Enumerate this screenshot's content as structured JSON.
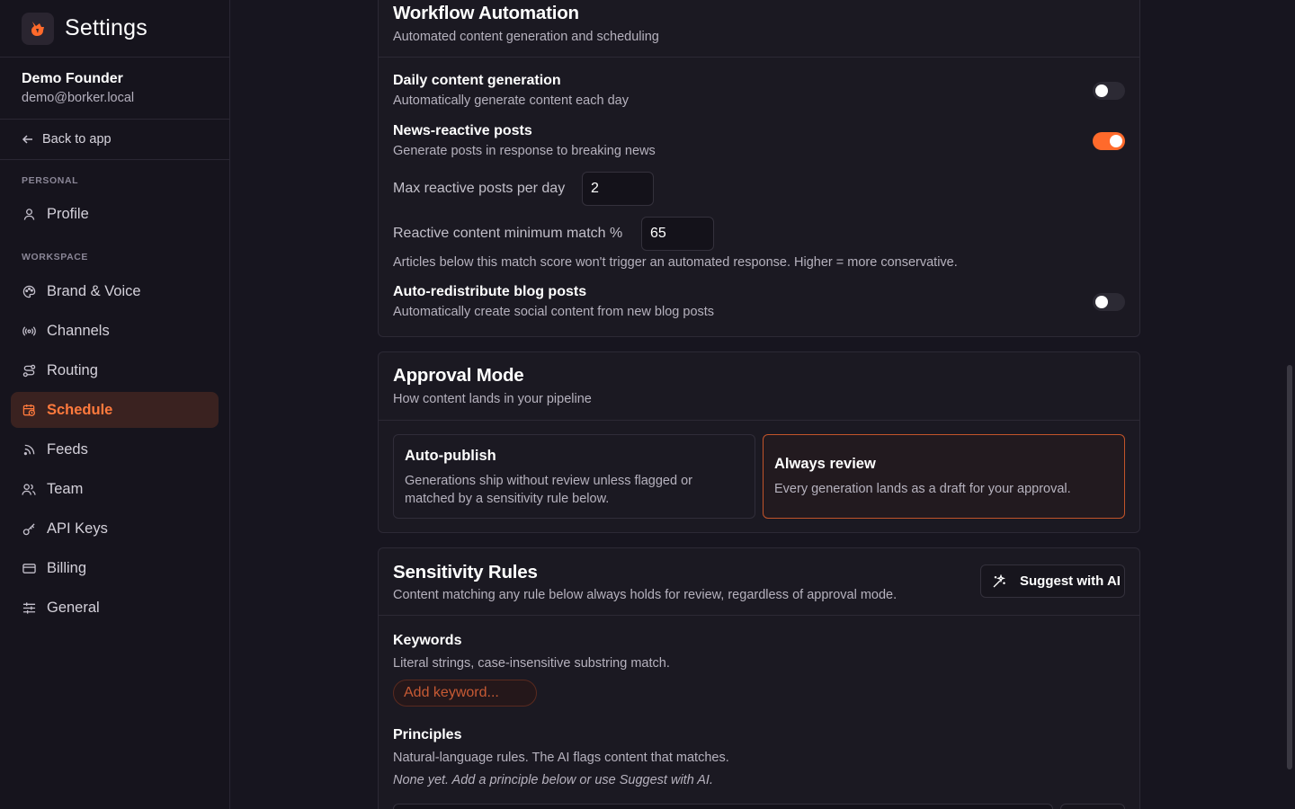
{
  "app": {
    "title": "Settings"
  },
  "user": {
    "name": "Demo Founder",
    "email": "demo@borker.local"
  },
  "back": {
    "label": "Back to app"
  },
  "sidebar": {
    "personal_label": "PERSONAL",
    "workspace_label": "WORKSPACE",
    "items": [
      {
        "label": "Profile",
        "icon": "user-icon"
      },
      {
        "label": "Brand & Voice",
        "icon": "palette-icon"
      },
      {
        "label": "Channels",
        "icon": "broadcast-icon"
      },
      {
        "label": "Routing",
        "icon": "route-icon"
      },
      {
        "label": "Schedule",
        "icon": "calendar-clock-icon",
        "active": true
      },
      {
        "label": "Feeds",
        "icon": "rss-icon"
      },
      {
        "label": "Team",
        "icon": "team-icon"
      },
      {
        "label": "API Keys",
        "icon": "key-icon"
      },
      {
        "label": "Billing",
        "icon": "credit-card-icon"
      },
      {
        "label": "General",
        "icon": "sliders-icon"
      }
    ]
  },
  "workflow": {
    "title": "Workflow Automation",
    "subtitle": "Automated content generation and scheduling",
    "daily": {
      "title": "Daily content generation",
      "desc": "Automatically generate content each day",
      "enabled": false
    },
    "news": {
      "title": "News-reactive posts",
      "desc": "Generate posts in response to breaking news",
      "enabled": true
    },
    "max_reactive": {
      "label": "Max reactive posts per day",
      "value": "2"
    },
    "min_match": {
      "label": "Reactive content minimum match %",
      "value": "65"
    },
    "match_help": "Articles below this match score won't trigger an automated response. Higher = more conservative.",
    "redistribute": {
      "title": "Auto-redistribute blog posts",
      "desc": "Automatically create social content from new blog posts",
      "enabled": false
    }
  },
  "approval": {
    "title": "Approval Mode",
    "subtitle": "How content lands in your pipeline",
    "options": [
      {
        "title": "Auto-publish",
        "desc": "Generations ship without review unless flagged or matched by a sensitivity rule below.",
        "selected": false
      },
      {
        "title": "Always review",
        "desc": "Every generation lands as a draft for your approval.",
        "selected": true
      }
    ]
  },
  "sensitivity": {
    "title": "Sensitivity Rules",
    "subtitle": "Content matching any rule below always holds for review, regardless of approval mode.",
    "suggest_label": "Suggest with AI",
    "keywords": {
      "title": "Keywords",
      "desc": "Literal strings, case-insensitive substring match.",
      "placeholder": "Add keyword..."
    },
    "principles": {
      "title": "Principles",
      "desc": "Natural-language rules. The AI flags content that matches.",
      "empty": "None yet. Add a principle below or use Suggest with AI."
    }
  },
  "colors": {
    "accent": "#ff6a2b",
    "background": "#17151f",
    "card": "#1b1922"
  }
}
